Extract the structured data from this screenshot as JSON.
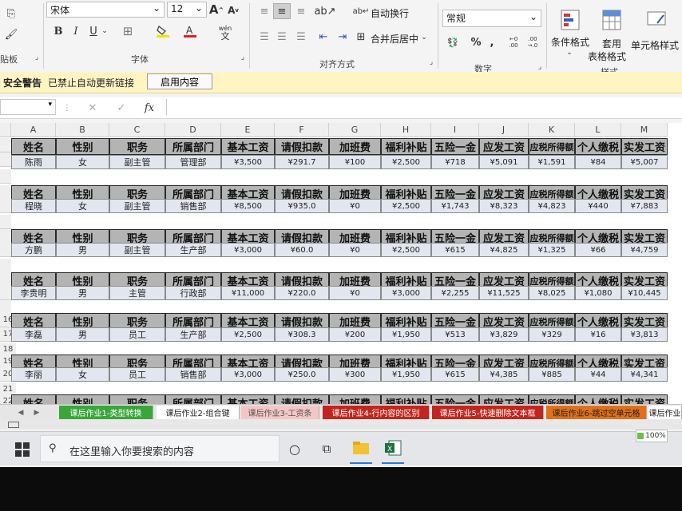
{
  "ribbon": {
    "clipboard_group": "贴板",
    "font_name": "宋体",
    "font_size": "12",
    "grow_font": "A",
    "shrink_font": "A",
    "bold": "B",
    "italic": "I",
    "underline": "U",
    "wen_label": "wén",
    "wen_char": "文",
    "font_group": "字体",
    "wrap_text": "自动换行",
    "merge_center": "合并后居中",
    "align_group": "对齐方式",
    "number_format": "常规",
    "percent": "%",
    "comma": ",",
    "number_group": "数字",
    "cond_format": "条件格式",
    "table_format_1": "套用",
    "table_format_2": "表格格式",
    "cell_style": "单元格样式",
    "styles_group": "样式"
  },
  "security_bar": {
    "title": "安全警告",
    "message": "已禁止自动更新链接",
    "button": "启用内容"
  },
  "formula_bar": {
    "cancel": "✕",
    "confirm": "✓",
    "fx": "fx",
    "value": ""
  },
  "columns": [
    "A",
    "B",
    "C",
    "D",
    "E",
    "F",
    "G",
    "H",
    "I",
    "J",
    "K",
    "L",
    "M"
  ],
  "headers": [
    "姓名",
    "性别",
    "职务",
    "所属部门",
    "基本工资",
    "请假扣款",
    "加班费",
    "福利补贴",
    "五险一金",
    "应发工资",
    "应税所得额",
    "个人缴税",
    "实发工资"
  ],
  "row_numbers": [
    "",
    "",
    "",
    "",
    "",
    "",
    "",
    "",
    "",
    "",
    "",
    "",
    "",
    "",
    "16",
    "17",
    "18",
    "19",
    "20",
    "21",
    "22"
  ],
  "records": [
    [
      "陈雨",
      "女",
      "副主管",
      "管理部",
      "¥3,500",
      "¥291.7",
      "¥100",
      "¥2,500",
      "¥718",
      "¥5,091",
      "¥1,591",
      "¥84",
      "¥5,007"
    ],
    [
      "程晓",
      "女",
      "副主管",
      "销售部",
      "¥8,500",
      "¥935.0",
      "¥0",
      "¥2,500",
      "¥1,743",
      "¥8,323",
      "¥4,823",
      "¥440",
      "¥7,883"
    ],
    [
      "方鹏",
      "男",
      "副主管",
      "生产部",
      "¥3,000",
      "¥60.0",
      "¥0",
      "¥2,500",
      "¥615",
      "¥4,825",
      "¥1,325",
      "¥66",
      "¥4,759"
    ],
    [
      "李贵明",
      "男",
      "主管",
      "行政部",
      "¥11,000",
      "¥220.0",
      "¥0",
      "¥3,000",
      "¥2,255",
      "¥11,525",
      "¥8,025",
      "¥1,080",
      "¥10,445"
    ],
    [
      "李磊",
      "男",
      "员工",
      "生产部",
      "¥2,500",
      "¥308.3",
      "¥200",
      "¥1,950",
      "¥513",
      "¥3,829",
      "¥329",
      "¥16",
      "¥3,813"
    ],
    [
      "李丽",
      "女",
      "员工",
      "销售部",
      "¥3,000",
      "¥250.0",
      "¥300",
      "¥1,950",
      "¥615",
      "¥4,385",
      "¥885",
      "¥44",
      "¥4,341"
    ]
  ],
  "sheet_tabs": [
    {
      "label": "课后作业1-类型转换",
      "color": "#3aa53a",
      "text": "#ffffff"
    },
    {
      "label": "课后作业2-组合键",
      "color": "#ffffff",
      "text": "#222222"
    },
    {
      "label": "课后作业3-工资条",
      "color": "#f4c6c6",
      "text": "#555555"
    },
    {
      "label": "课后作业4-行内容的区别",
      "color": "#c0261d",
      "text": "#ffffff"
    },
    {
      "label": "课后作业5-快速删除文本框",
      "color": "#c0261d",
      "text": "#ffffff"
    },
    {
      "label": "课后作业6-跳过空单元格",
      "color": "#e0701a",
      "text": "#222222"
    },
    {
      "label": "课后作业",
      "color": "#ffffff",
      "text": "#222222"
    }
  ],
  "taskbar": {
    "search_placeholder": "在这里输入你要搜索的内容",
    "battery": "100%"
  },
  "colors": {
    "header_fill": "#b4b4b4",
    "data_fill": "#e2e7ef",
    "warning_bar": "#fff5c4",
    "excel_green": "#1e7145"
  }
}
